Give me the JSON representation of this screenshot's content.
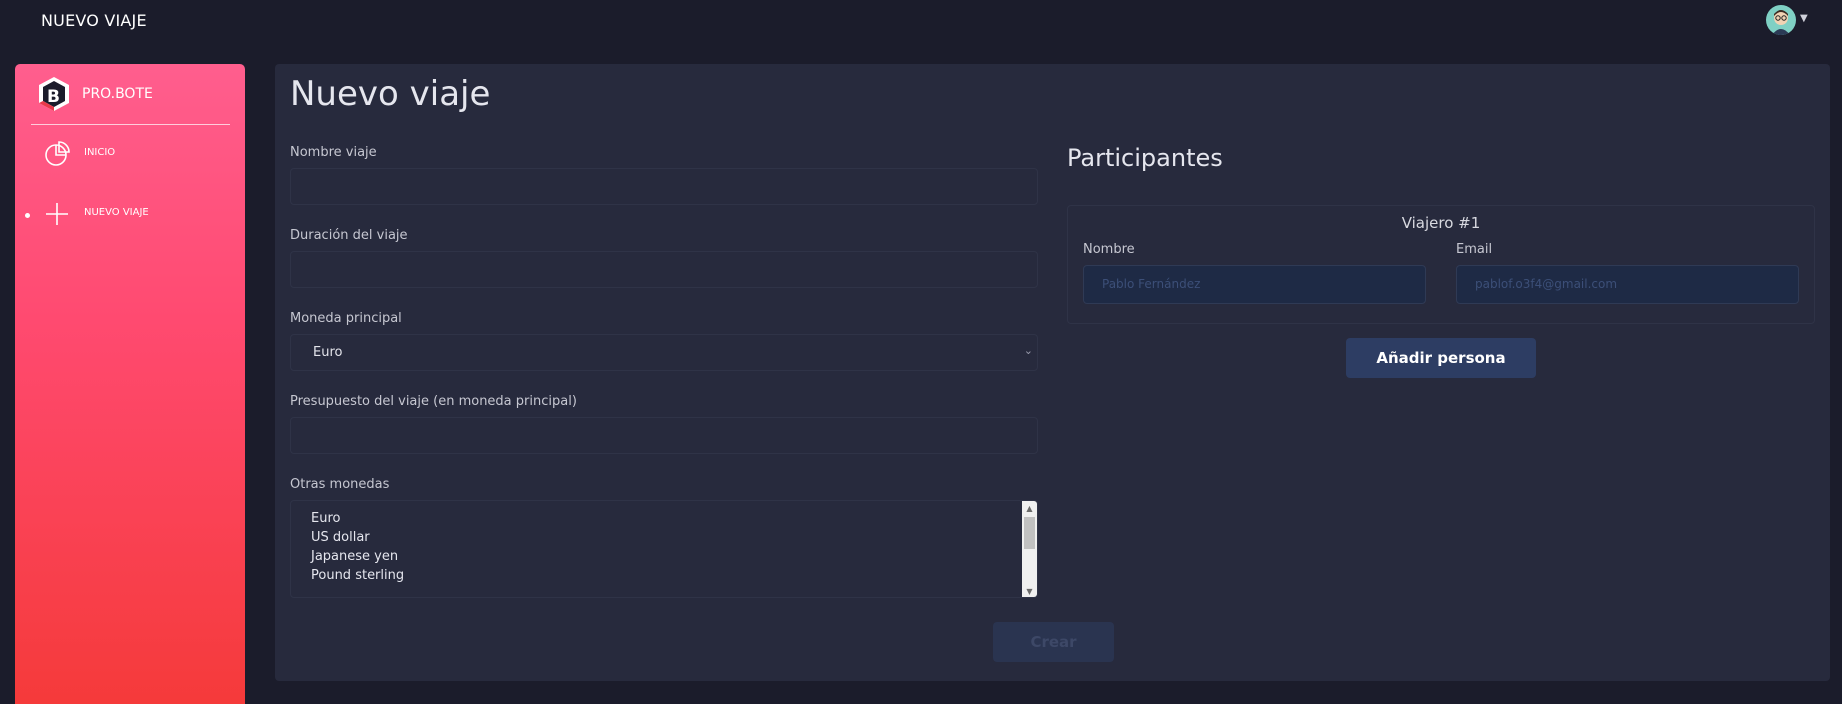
{
  "app": {
    "page_title_top": "NUEVO VIAJE"
  },
  "sidebar": {
    "brand_name": "PRO.BOTE",
    "items": [
      {
        "label": "INICIO",
        "icon": "pie-chart-icon",
        "active": false
      },
      {
        "label": "NUEVO VIAJE",
        "icon": "plus-icon",
        "active": true
      }
    ]
  },
  "form": {
    "title": "Nuevo viaje",
    "trip_name": {
      "label": "Nombre viaje",
      "value": ""
    },
    "duration": {
      "label": "Duración del viaje",
      "value": ""
    },
    "main_currency": {
      "label": "Moneda principal",
      "selected": "Euro"
    },
    "budget": {
      "label": "Presupuesto del viaje (en moneda principal)",
      "value": ""
    },
    "other_currencies": {
      "label": "Otras monedas",
      "options": [
        "Euro",
        "US dollar",
        "Japanese yen",
        "Pound sterling"
      ]
    },
    "create_label": "Crear"
  },
  "participants": {
    "title": "Participantes",
    "traveler": {
      "title": "Viajero #1",
      "name_label": "Nombre",
      "name_placeholder": "Pablo Fernández",
      "email_label": "Email",
      "email_placeholder": "pablof.o3f4@gmail.com"
    },
    "add_label": "Añadir persona"
  }
}
